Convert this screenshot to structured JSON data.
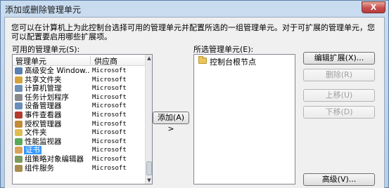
{
  "window": {
    "title": "添加或删除管理单元",
    "close_glyph": "X"
  },
  "description": "您可以在计算机上为此控制台选择可用的管理单元并配置所选的一组管理单元。对于可扩展的管理单元，您可以配置要启用哪些扩展项。",
  "available": {
    "label": "可用的管理单元(S):",
    "col_name": "管理单元",
    "col_vendor": "供应商",
    "items": [
      {
        "name": "高级安全 Window...",
        "vendor": "Microsoft",
        "color": "#5a7fb0"
      },
      {
        "name": "共享文件夹",
        "vendor": "Microsoft",
        "color": "#d3a43c"
      },
      {
        "name": "计算机管理",
        "vendor": "Microsoft",
        "color": "#6f8fb5"
      },
      {
        "name": "任务计划程序",
        "vendor": "Microsoft",
        "color": "#8a8a8a"
      },
      {
        "name": "设备管理器",
        "vendor": "Microsoft",
        "color": "#6b8eb8"
      },
      {
        "name": "事件查看器",
        "vendor": "Microsoft",
        "color": "#b23a2f"
      },
      {
        "name": "授权管理器",
        "vendor": "Microsoft",
        "color": "#c28a39"
      },
      {
        "name": "文件夹",
        "vendor": "Microsoft",
        "color": "#e0bd54"
      },
      {
        "name": "性能监视器",
        "vendor": "Microsoft",
        "color": "#5aa85a"
      },
      {
        "name": "证书",
        "vendor": "Microsoft",
        "color": "#d9a35a",
        "selected": true
      },
      {
        "name": "组策略对象编辑器",
        "vendor": "Microsoft",
        "color": "#7b9a5b"
      },
      {
        "name": "组件服务",
        "vendor": "Microsoft",
        "color": "#a88c4f"
      }
    ]
  },
  "add_button": "添加(A) >",
  "selected": {
    "label": "所选管理单元(E):",
    "root": "控制台根节点"
  },
  "buttons": {
    "edit_ext": "编辑扩展(X)...",
    "remove": "删除(R)",
    "move_up": "上移(U)",
    "move_down": "下移(D)",
    "advanced": "高级(V)..."
  }
}
